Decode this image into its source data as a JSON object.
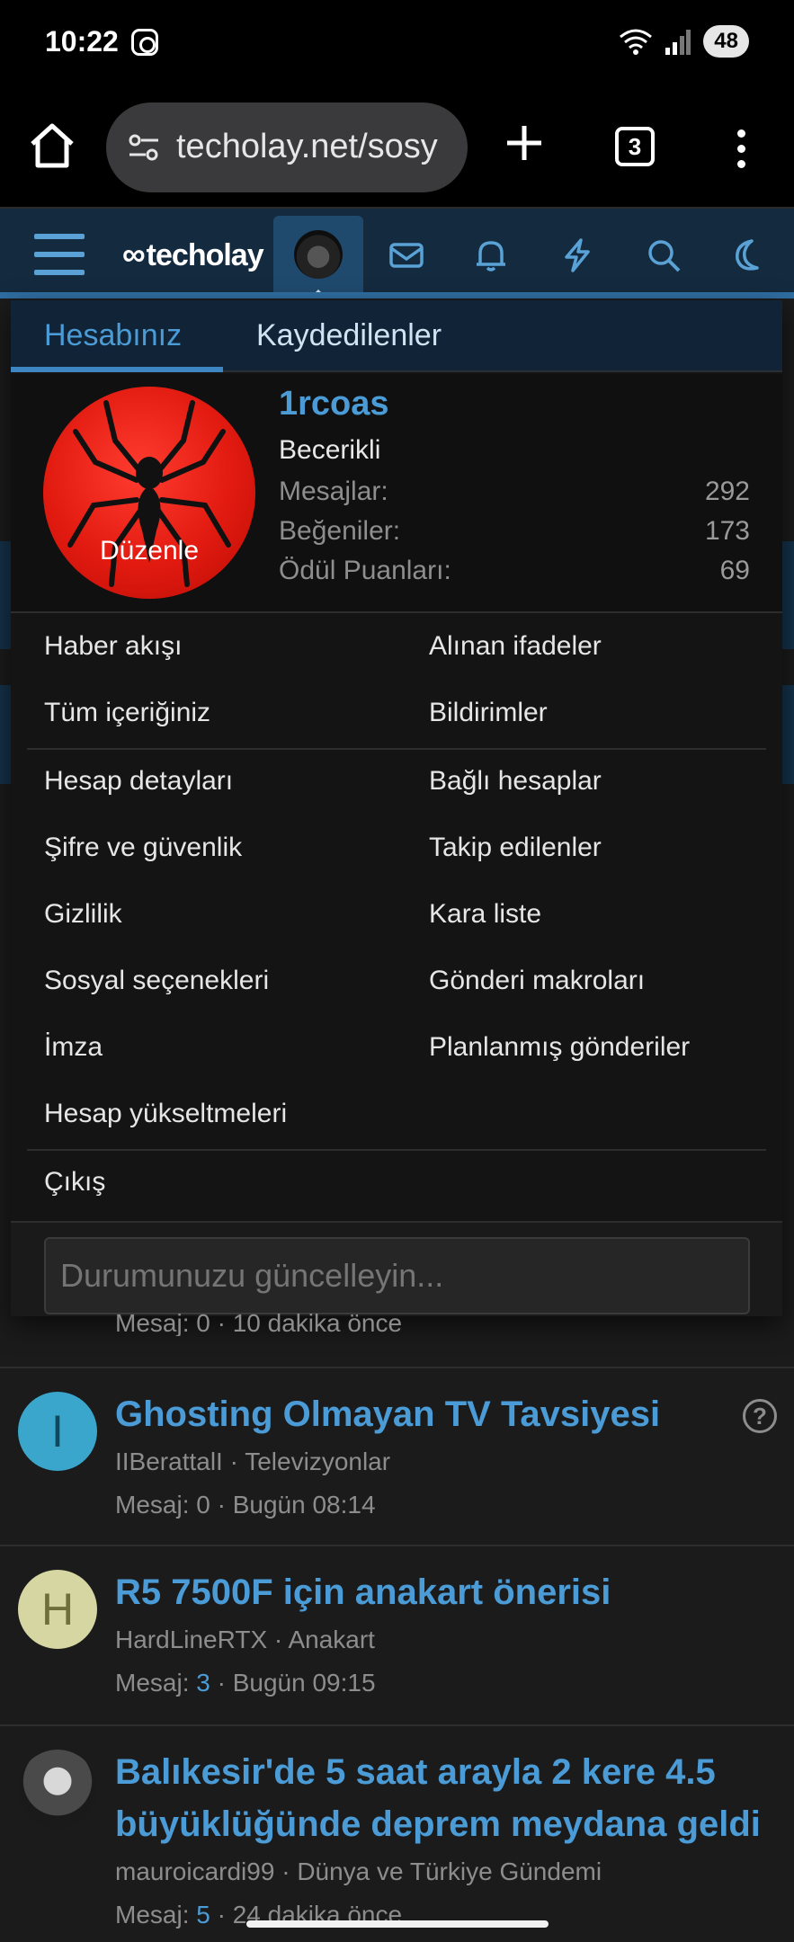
{
  "status_bar": {
    "time": "10:22",
    "battery": "48"
  },
  "browser": {
    "url": "techolay.net/sosy",
    "tab_count": "3"
  },
  "site": {
    "logo": "techolay"
  },
  "account_menu": {
    "tabs": {
      "account": "Hesabınız",
      "saved": "Kaydedilenler"
    },
    "profile": {
      "username": "1rcoas",
      "title": "Becerikli",
      "edit_label": "Düzenle",
      "stats": [
        {
          "label": "Mesajlar:",
          "value": "292"
        },
        {
          "label": "Beğeniler:",
          "value": "173"
        },
        {
          "label": "Ödül Puanları:",
          "value": "69"
        }
      ]
    },
    "links": {
      "news_feed": "Haber akışı",
      "reactions_received": "Alınan ifadeler",
      "your_content": "Tüm içeriğiniz",
      "alerts": "Bildirimler",
      "account_details": "Hesap detayları",
      "connected_accounts": "Bağlı hesaplar",
      "password_security": "Şifre ve güvenlik",
      "following": "Takip edilenler",
      "privacy": "Gizlilik",
      "ignored": "Kara liste",
      "social_options": "Sosyal seçenekleri",
      "post_macros": "Gönderi makroları",
      "signature": "İmza",
      "scheduled_posts": "Planlanmış gönderiler",
      "upgrades": "Hesap yükseltmeleri",
      "logout": "Çıkış"
    },
    "status_placeholder": "Durumunuzu güncelleyin..."
  },
  "partial_meta": "Mesaj: 0 · 10 dakika önce",
  "threads": [
    {
      "avatar_letter": "I",
      "title": "Ghosting Olmayan TV Tavsiyesi",
      "author": "IIBerattalI",
      "forum": "Televizyonlar",
      "msg_label": "Mesaj:",
      "msg_count": "0",
      "time": "Bugün 08:14",
      "colors": {
        "avatar_bg": "#3aa6cc",
        "avatar_fg": "#10485c"
      }
    },
    {
      "avatar_letter": "H",
      "title": "R5 7500F için anakart önerisi",
      "author": "HardLineRTX",
      "forum": "Anakart",
      "msg_label": "Mesaj:",
      "msg_count": "3",
      "time": "Bugün 09:15",
      "colors": {
        "avatar_bg": "#d6d6a3",
        "avatar_fg": "#6f6f3c"
      }
    },
    {
      "avatar_letter": "",
      "title": "Balıkesir'de 5 saat arayla 2 kere 4.5 büyüklüğünde deprem meydana geldi",
      "author": "mauroicardi99",
      "forum": "Dünya ve Türkiye Gündemi",
      "msg_label": "Mesaj:",
      "msg_count": "5",
      "time": "24 dakika önce",
      "colors": {
        "avatar_bg": "#2a2a2a",
        "avatar_fg": "#cccccc"
      }
    }
  ],
  "colors": {
    "accent": "#4a9bd6",
    "header_bg": "#142a3e",
    "menu_bg": "#141414"
  }
}
